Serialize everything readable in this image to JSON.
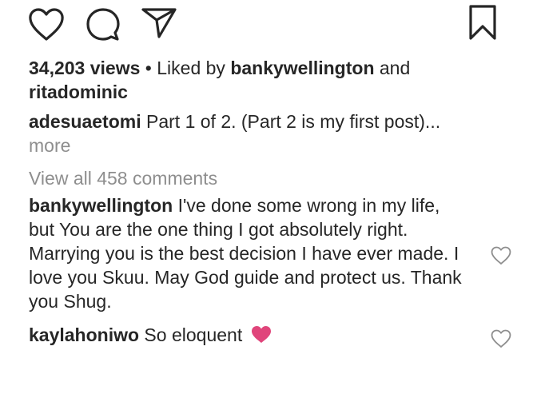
{
  "actions": {
    "like_icon": "heart-outline-icon",
    "comment_icon": "speech-bubble-icon",
    "share_icon": "paper-plane-icon",
    "save_icon": "bookmark-icon"
  },
  "post": {
    "views": "34,203 views",
    "separator": " • ",
    "liked_by_prefix": "Liked by ",
    "liked_by_user": "bankywellington",
    "liked_by_and": " and",
    "liked_by_user2": "ritadominic",
    "caption_user": "adesuaetomi",
    "caption_text": " Part 1 of 2. (Part 2 is my first post)...",
    "more_label": "more",
    "view_all_comments": "View all 458 comments"
  },
  "comments": [
    {
      "username": "bankywellington",
      "text": " I've done some wrong in my life, but You are the one thing I got absolutely right. Marrying you is the best decision I have ever made. I love you Skuu. May God guide and protect us. Thank you Shug."
    },
    {
      "username": "kaylahoniwo",
      "text": " So eloquent ",
      "emoji": "pink-heart-emoji"
    }
  ],
  "colors": {
    "text": "#262626",
    "muted": "#8e8e8e",
    "heart_emoji": "#e0457b"
  }
}
